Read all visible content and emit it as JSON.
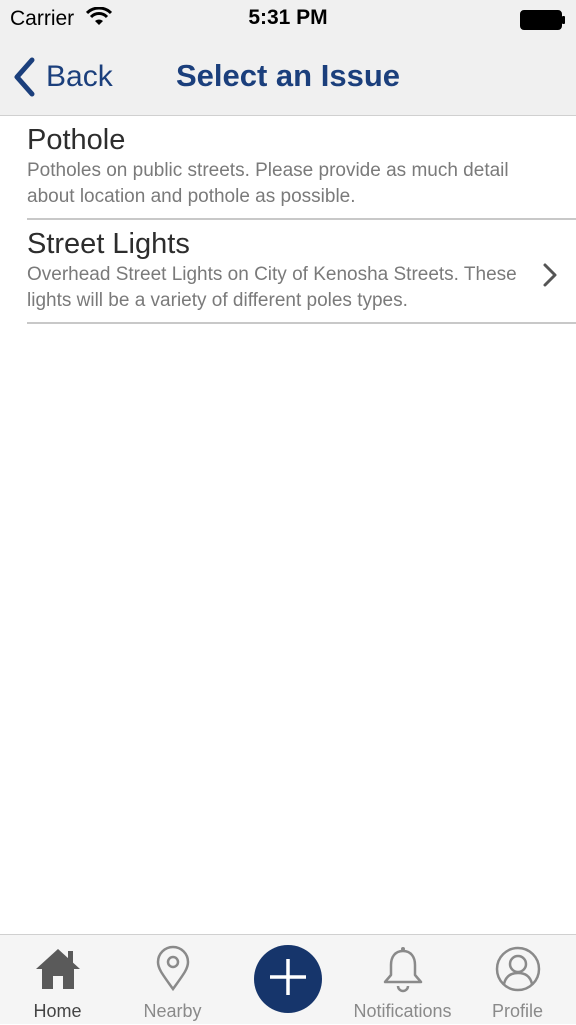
{
  "status_bar": {
    "carrier": "Carrier",
    "time": "5:31 PM"
  },
  "nav": {
    "back_label": "Back",
    "title": "Select an Issue"
  },
  "issues": [
    {
      "title": "Pothole",
      "description": "Potholes on public streets. Please provide as much detail about location and pothole as possible."
    },
    {
      "title": "Street Lights",
      "description": "Overhead Street Lights on City of Kenosha Streets. These lights will be a variety of different poles types."
    }
  ],
  "tabs": [
    {
      "label": "Home",
      "icon": "home-icon",
      "active": true
    },
    {
      "label": "Nearby",
      "icon": "location-pin-icon",
      "active": false
    },
    {
      "label": "",
      "icon": "plus-icon",
      "active": false
    },
    {
      "label": "Notifications",
      "icon": "bell-icon",
      "active": false
    },
    {
      "label": "Profile",
      "icon": "user-icon",
      "active": false
    }
  ],
  "colors": {
    "brand": "#1b3f7c",
    "fab": "#16356b",
    "bar_bg": "#f0f0f0"
  }
}
